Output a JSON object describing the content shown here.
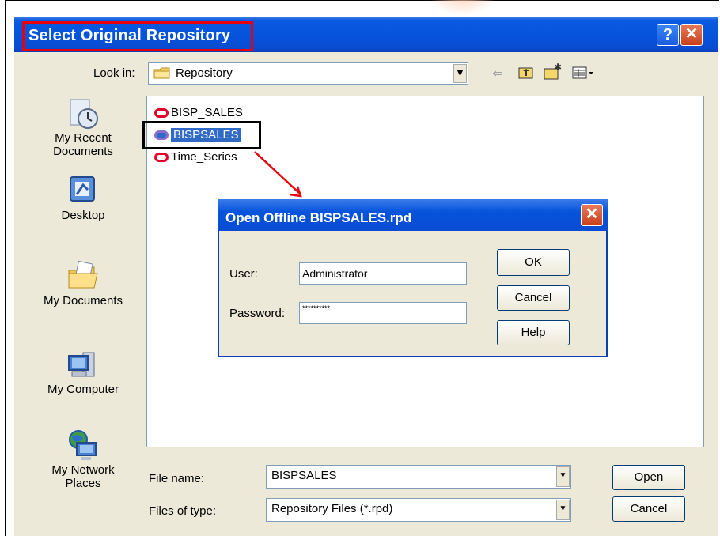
{
  "window": {
    "title": "Select Original Repository",
    "help_glyph": "?",
    "close_glyph": "✕"
  },
  "look_in": {
    "label": "Look in:",
    "value": "Repository",
    "toolbar_icons": [
      "back-arrow-icon",
      "up-folder-icon",
      "new-folder-icon",
      "view-menu-icon"
    ]
  },
  "places": [
    {
      "label": "My Recent Documents",
      "icon": "recent-documents-icon"
    },
    {
      "label": "Desktop",
      "icon": "desktop-icon"
    },
    {
      "label": "My Documents",
      "icon": "my-documents-icon"
    },
    {
      "label": "My Computer",
      "icon": "my-computer-icon"
    },
    {
      "label": "My Network Places",
      "icon": "network-places-icon"
    }
  ],
  "files": [
    {
      "name": "BISP_SALES",
      "selected": false
    },
    {
      "name": "BISPSALES",
      "selected": true
    },
    {
      "name": "Time_Series",
      "selected": false
    }
  ],
  "file_name": {
    "label": "File name:",
    "value": "BISPSALES"
  },
  "file_type": {
    "label": "Files of type:",
    "value": "Repository Files (*.rpd)"
  },
  "buttons": {
    "open": "Open",
    "cancel": "Cancel"
  },
  "offline_dialog": {
    "title": "Open Offline BISPSALES.rpd",
    "user_label": "User:",
    "user_value": "Administrator",
    "password_label": "Password:",
    "password_value": "**********",
    "ok": "OK",
    "cancel": "Cancel",
    "help": "Help"
  },
  "colors": {
    "title_bar": "#0654dc",
    "highlight_red": "#e8000b",
    "selection": "#316ac5",
    "dialog_bg": "#ece9d8"
  }
}
